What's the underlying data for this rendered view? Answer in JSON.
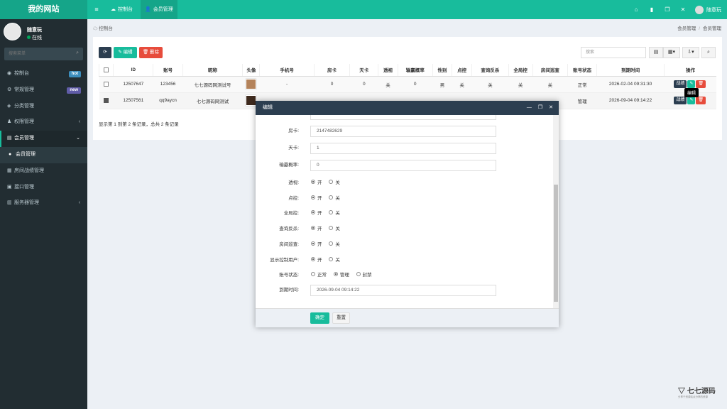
{
  "app": {
    "logo": "我的网站"
  },
  "topbar": {
    "tabs": [
      {
        "icon": "☁",
        "label": "控制台"
      },
      {
        "icon": "👤",
        "label": "会员管理"
      }
    ],
    "icons": [
      "home-icon",
      "trash-icon",
      "copy-icon",
      "expand-icon"
    ],
    "user_name": "随意玩"
  },
  "sidebar": {
    "user_name": "随意玩",
    "status": "在线",
    "search_placeholder": "搜索菜单",
    "items": [
      {
        "icon": "◉",
        "label": "控制台",
        "badge": "hot"
      },
      {
        "icon": "⚙",
        "label": "常规管理",
        "badge": "new"
      },
      {
        "icon": "◈",
        "label": "分类管理"
      },
      {
        "icon": "♟",
        "label": "权限管理",
        "arrow": "‹"
      },
      {
        "icon": "▤",
        "label": "会员管理",
        "arrow": "⌄"
      },
      {
        "icon": "●",
        "label": "会员管理"
      },
      {
        "icon": "▦",
        "label": "房间战绩管理"
      },
      {
        "icon": "▣",
        "label": "接口管理"
      },
      {
        "icon": "▥",
        "label": "服务器管理",
        "arrow": "‹"
      }
    ]
  },
  "breadcrumb": {
    "left": "控制台",
    "right": [
      "会员管理",
      "/",
      "会员管理"
    ]
  },
  "toolbar": {
    "refresh": "⟳",
    "edit": "✎ 编辑",
    "delete": "🗑 删除",
    "search_placeholder": "搜索"
  },
  "table": {
    "headers": [
      "ID",
      "账号",
      "昵称",
      "头像",
      "手机号",
      "房卡",
      "天卡",
      "透视",
      "输赢概率",
      "性别",
      "点控",
      "查询反杀",
      "全局控",
      "房间巡查",
      "账号状态",
      "到期时间",
      "操作"
    ],
    "rows": [
      {
        "checked": false,
        "id": "12507647",
        "account": "123456",
        "nickname": "七七源码网测试号",
        "phone": "-",
        "room_card": "0",
        "day_card": "0",
        "perspective": "关",
        "win_rate": "0",
        "gender": "男",
        "point_control": "关",
        "query": "关",
        "global": "关",
        "patrol": "关",
        "status": "正常",
        "expire": "2026-02-04 09:31:30"
      },
      {
        "checked": true,
        "id": "12507561",
        "account": "qq9aycn",
        "nickname": "七七源码网测试",
        "phone": "",
        "room_card": "",
        "day_card": "",
        "perspective": "",
        "win_rate": "",
        "gender": "",
        "point_control": "",
        "query": "",
        "global": "",
        "patrol": "",
        "status": "管理",
        "expire": "2026-09-04 09:14:22"
      }
    ],
    "op_labels": {
      "stats": "战绩"
    },
    "tooltip": "编辑",
    "footer": "显示第 1 到第 2 条记录，总共 2 条记录"
  },
  "modal": {
    "title": "编辑",
    "fields": [
      {
        "label": "房卡:",
        "value": "2147482629"
      },
      {
        "label": "天卡:",
        "value": "1"
      },
      {
        "label": "输赢概率:",
        "value": "0"
      }
    ],
    "radios": [
      {
        "label": "透视:",
        "options": [
          "开",
          "关"
        ],
        "selected": 0
      },
      {
        "label": "点控:",
        "options": [
          "开",
          "关"
        ],
        "selected": 0
      },
      {
        "label": "全局控:",
        "options": [
          "开",
          "关"
        ],
        "selected": 0
      },
      {
        "label": "查询反杀:",
        "options": [
          "开",
          "关"
        ],
        "selected": 0
      },
      {
        "label": "房间巡查:",
        "options": [
          "开",
          "关"
        ],
        "selected": 0
      },
      {
        "label": "显示控制用户:",
        "options": [
          "开",
          "关"
        ],
        "selected": 0
      },
      {
        "label": "账号状态:",
        "options": [
          "正常",
          "管理",
          "封禁"
        ],
        "selected": 1
      }
    ],
    "expire": {
      "label": "到期时间:",
      "value": "2026-09-04 09:14:22"
    },
    "ok": "确定",
    "reset": "重置"
  },
  "watermark": {
    "logo": "七七源码",
    "sub": "分享于资源站点分享的资源"
  },
  "colors": {
    "primary": "#18bc9c",
    "sidebar": "#222d32",
    "dark": "#2c3e50",
    "danger": "#e74c3c"
  }
}
